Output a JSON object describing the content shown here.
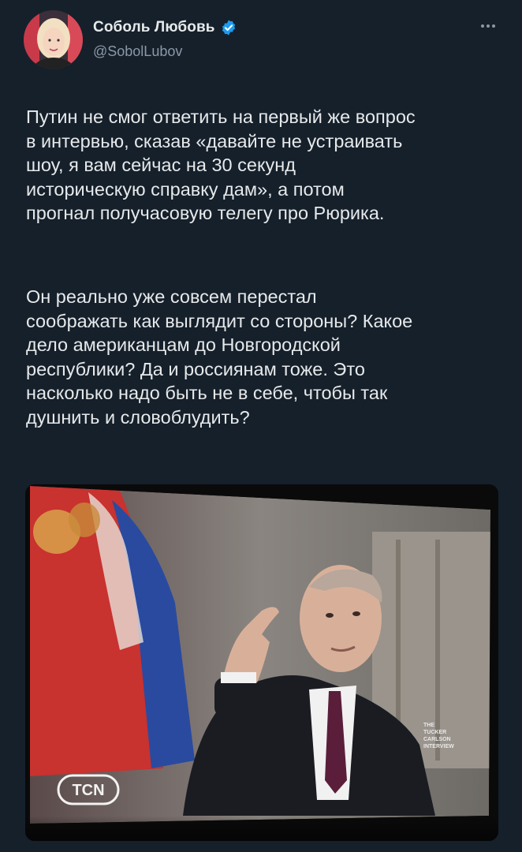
{
  "author": {
    "name": "Соболь Любовь",
    "handle": "@SobolLubov",
    "verified": true,
    "verified_color": "#1d9bf0",
    "avatar_icon": "profile-photo"
  },
  "tweet": {
    "paragraphs": [
      "Путин не смог ответить на первый же вопрос\nв интервью, сказав «давайте не устраивать\nшоу, я вам сейчас на 30 секунд\nисторическую справку дам», а потом\nпрогнал получасовую телегу про Рюрика.",
      "Он реально уже совсем перестал\nсоображать как выглядит со стороны? Какое\nдело американцам до Новгородской\nреспублики? Да и россиянам тоже. Это\nнасколько надо быть не в себе, чтобы так\nдушнить и словоблудить?"
    ]
  },
  "media": {
    "logo_text": "TCN",
    "watermark_lines": [
      "THE",
      "TUCKER",
      "CARLSON",
      "INTERVIEW"
    ]
  },
  "colors": {
    "background": "#15202b",
    "text": "#e7e9ea",
    "secondary": "#8b98a5"
  }
}
